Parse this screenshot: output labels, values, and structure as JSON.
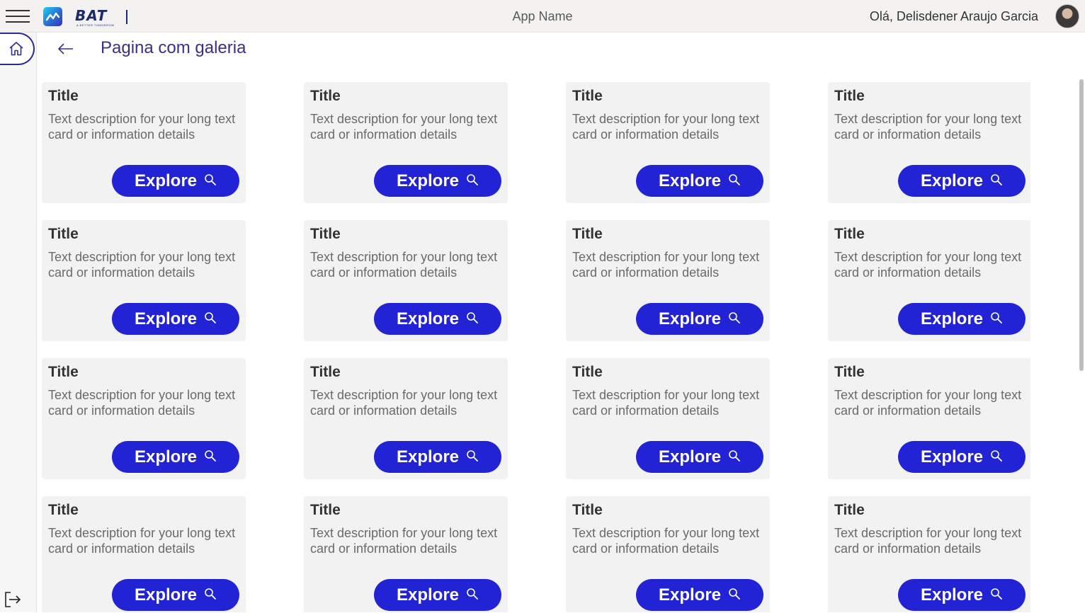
{
  "header": {
    "logo_text": "BAT",
    "logo_subtext": "A BETTER TOMORROW",
    "app_name": "App Name",
    "greeting": "Olá, Delisdener Araujo Garcia"
  },
  "rail": {
    "items": [
      {
        "icon": "home-icon"
      },
      {
        "icon": "logout-icon"
      }
    ]
  },
  "page": {
    "title": "Pagina com galeria"
  },
  "colors": {
    "accent": "#2323d6",
    "title_purple": "#3a2f8a",
    "card_bg": "#f3f2f3"
  },
  "gallery": {
    "cards": [
      {
        "title": "Title",
        "description": "Text description for your long text card or information details",
        "button_label": "Explore"
      },
      {
        "title": "Title",
        "description": "Text description for your long text card or information details",
        "button_label": "Explore"
      },
      {
        "title": "Title",
        "description": "Text description for your long text card or information details",
        "button_label": "Explore"
      },
      {
        "title": "Title",
        "description": "Text description for your long text card or information details",
        "button_label": "Explore"
      },
      {
        "title": "Title",
        "description": "Text description for your long text card or information details",
        "button_label": "Explore"
      },
      {
        "title": "Title",
        "description": "Text description for your long text card or information details",
        "button_label": "Explore"
      },
      {
        "title": "Title",
        "description": "Text description for your long text card or information details",
        "button_label": "Explore"
      },
      {
        "title": "Title",
        "description": "Text description for your long text card or information details",
        "button_label": "Explore"
      },
      {
        "title": "Title",
        "description": "Text description for your long text card or information details",
        "button_label": "Explore"
      },
      {
        "title": "Title",
        "description": "Text description for your long text card or information details",
        "button_label": "Explore"
      },
      {
        "title": "Title",
        "description": "Text description for your long text card or information details",
        "button_label": "Explore"
      },
      {
        "title": "Title",
        "description": "Text description for your long text card or information details",
        "button_label": "Explore"
      },
      {
        "title": "Title",
        "description": "Text description for your long text card or information details",
        "button_label": "Explore"
      },
      {
        "title": "Title",
        "description": "Text description for your long text card or information details",
        "button_label": "Explore"
      },
      {
        "title": "Title",
        "description": "Text description for your long text card or information details",
        "button_label": "Explore"
      },
      {
        "title": "Title",
        "description": "Text description for your long text card or information details",
        "button_label": "Explore"
      }
    ]
  }
}
